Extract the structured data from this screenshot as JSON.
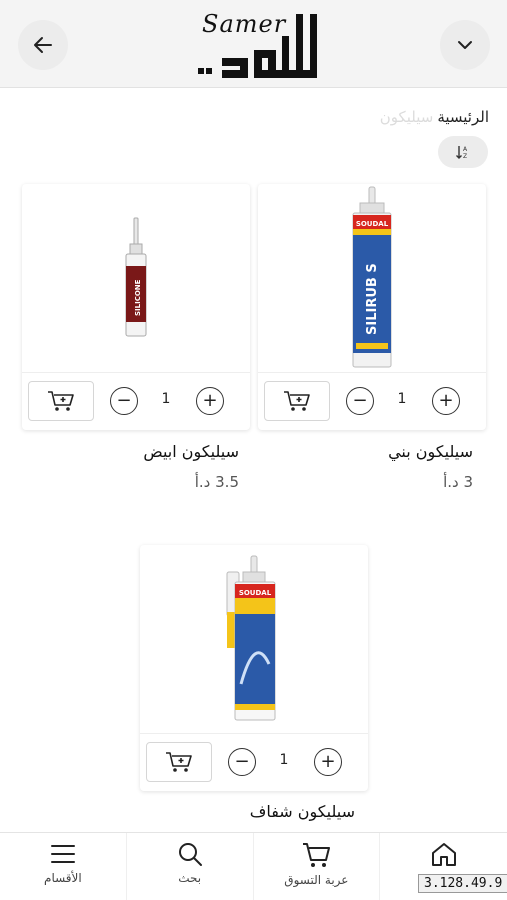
{
  "header": {
    "back_icon": "arrow-left-icon",
    "menu_icon": "chevron-down-icon",
    "logo_script": "Samer",
    "logo_arabic": "السمر"
  },
  "breadcrumb": {
    "home": "الرئيسية",
    "current": "سيليكون"
  },
  "sort_icon": "sort-az-icon",
  "products": [
    {
      "name": "سيليكون بني",
      "price": "3 د.أ",
      "qty": "1",
      "brand": "SOUDAL",
      "label": "SILIRUB S"
    },
    {
      "name": "سيليكون ابيض",
      "price": "3.5 د.أ",
      "qty": "1",
      "brand": "",
      "label": "SILICONE"
    },
    {
      "name": "سيليكون شفاف",
      "price": "",
      "qty": "1",
      "brand": "SOUDAL",
      "label": ""
    }
  ],
  "qty_controls": {
    "minus": "−",
    "plus": "+"
  },
  "bottom_nav": [
    {
      "label": "الأقسام",
      "icon": "hamburger-menu-icon"
    },
    {
      "label": "بحث",
      "icon": "search-icon"
    },
    {
      "label": "عربة التسوق",
      "icon": "cart-icon"
    },
    {
      "label": "",
      "icon": "home-icon"
    }
  ],
  "version": "3.128.49.9",
  "colors": {
    "header_bg": "#f4f4f4",
    "soudal_red": "#d7261e",
    "soudal_yellow": "#f4c419",
    "tube_blue": "#2b5aa8"
  }
}
